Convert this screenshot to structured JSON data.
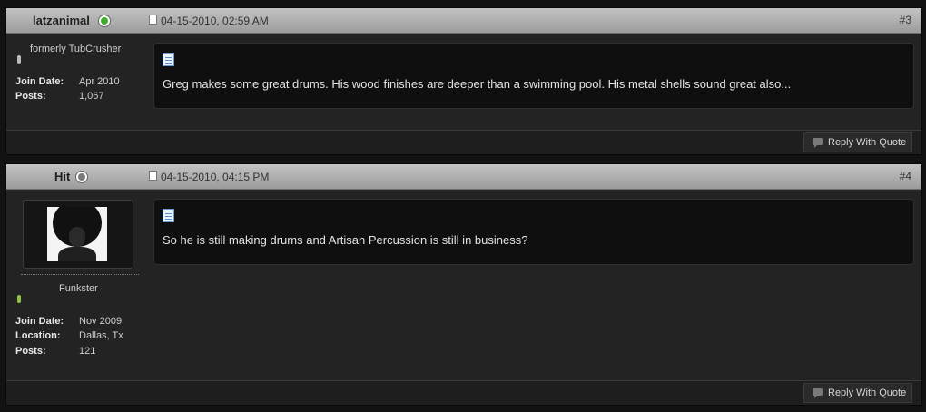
{
  "posts": [
    {
      "username": "latzanimal",
      "status": "online",
      "date": "04-15-2010, 02:59 AM",
      "post_number": "#3",
      "user_title": "formerly TubCrusher",
      "rep_color": "#bcbcbc",
      "stats": [
        {
          "label": "Join Date:",
          "value": "Apr 2010"
        },
        {
          "label": "Posts:",
          "value": "1,067"
        }
      ],
      "message": "Greg makes some great drums. His wood finishes are deeper than a swimming pool. His metal shells sound great also...",
      "reply_label": "Reply With Quote"
    },
    {
      "username": "Hit",
      "status": "offline",
      "date": "04-15-2010, 04:15 PM",
      "post_number": "#4",
      "user_title": "Funkster",
      "rep_color": "#8ec63f",
      "stats": [
        {
          "label": "Join Date:",
          "value": "Nov 2009"
        },
        {
          "label": "Location:",
          "value": "Dallas, Tx"
        },
        {
          "label": "Posts:",
          "value": "121"
        }
      ],
      "message": "So he is still making drums and Artisan Percussion is still in business?",
      "reply_label": "Reply With Quote"
    }
  ],
  "icons": {
    "online": "online-status-icon",
    "offline": "offline-status-icon",
    "post": "post-icon",
    "message": "document-icon",
    "reply": "reply-quote-icon"
  }
}
